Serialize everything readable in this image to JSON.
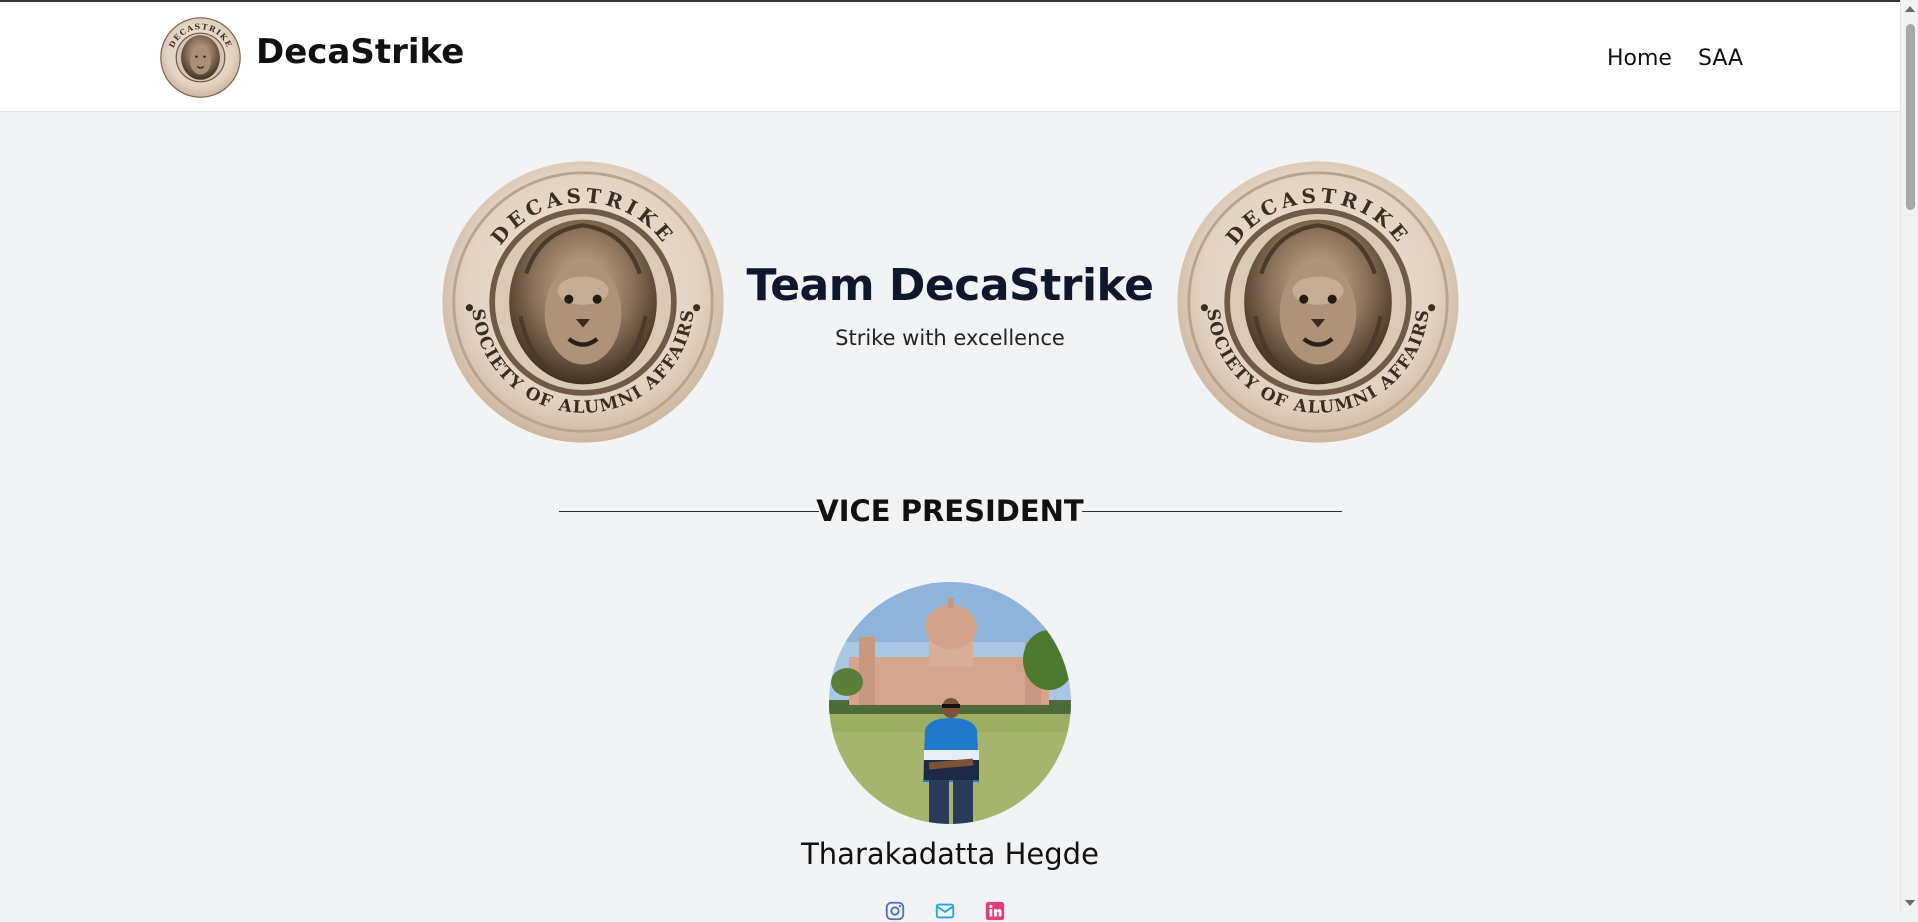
{
  "header": {
    "brand_name": "DecaStrike",
    "logo_icon": "lion-crest-logo",
    "nav": [
      {
        "label": "Home"
      },
      {
        "label": "SAA"
      }
    ]
  },
  "hero": {
    "title": "Team DecaStrike",
    "subtitle": "Strike with excellence",
    "emblem_text_top": "DECASTRIKE",
    "emblem_text_bottom": "SOCIETY OF ALUMNI AFFAIRS"
  },
  "section": {
    "title": "VICE PRESIDENT"
  },
  "member": {
    "name": "Tharakadatta Hegde",
    "photo_icon": "member-photo",
    "socials": [
      {
        "icon": "instagram-icon",
        "color": "#4f6fb8"
      },
      {
        "icon": "mail-icon",
        "color": "#23a7d6"
      },
      {
        "icon": "linkedin-icon",
        "color": "#e0407a"
      }
    ]
  },
  "colors": {
    "page_bg": "#f2f3f5",
    "navbar_bg": "#ffffff",
    "title_color": "#0f172a",
    "emblem_bronze": "#8a7358"
  }
}
